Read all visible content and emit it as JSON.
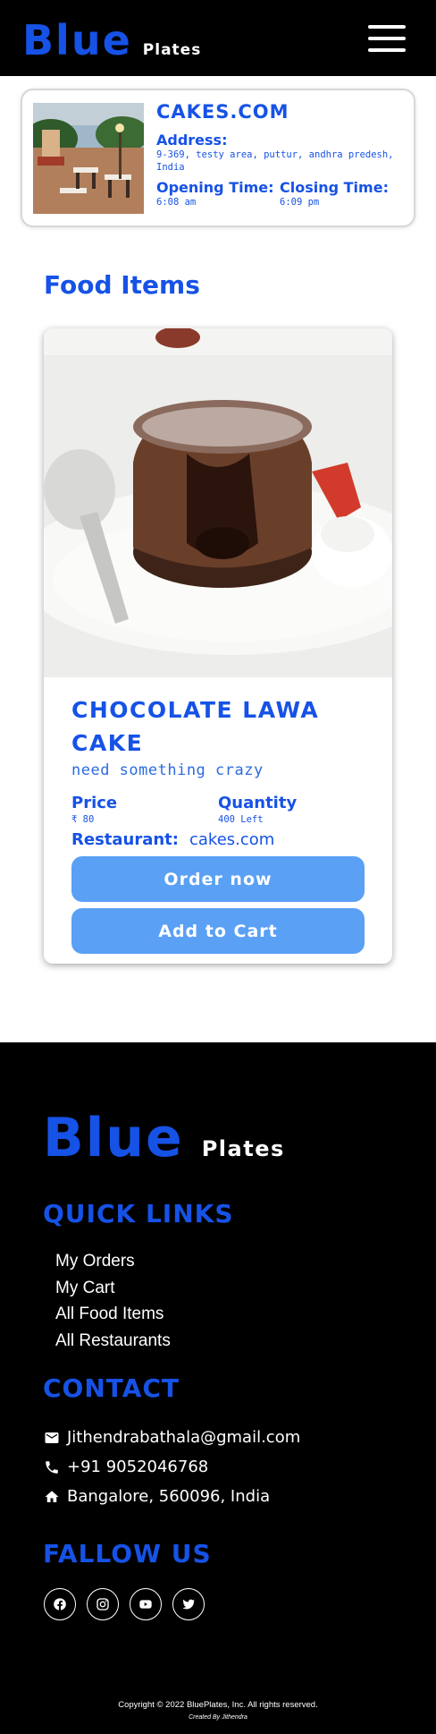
{
  "header": {
    "brand_main": "Blue",
    "brand_sub": "Plates",
    "menu_icon": "hamburger-menu-icon"
  },
  "restaurant": {
    "name": "CAKES.COM",
    "address_label": "Address:",
    "address": "9-369, testy area, puttur, andhra predesh, India",
    "opening_label": "Opening Time:",
    "opening_time": "6:08 am",
    "closing_label": "Closing Time:",
    "closing_time": "6:09 pm"
  },
  "section_title": "Food Items",
  "food": {
    "name": "CHOCOLATE LAWA CAKE",
    "description": "need something crazy",
    "price_label": "Price",
    "price": "₹ 80",
    "quantity_label": "Quantity",
    "quantity": "400 Left",
    "restaurant_label": "Restaurant:",
    "restaurant": "cakes.com",
    "order_button": "Order now",
    "cart_button": "Add to Cart"
  },
  "footer": {
    "brand_main": "Blue",
    "brand_sub": "Plates",
    "quick_links_title": "QUICK LINKS",
    "quick_links": [
      "My Orders",
      "My Cart",
      "All Food Items",
      "All Restaurants"
    ],
    "contact_title": "CONTACT",
    "contact": {
      "email": "Jithendrabathala@gmail.com",
      "phone": "+91 9052046768",
      "address": "Bangalore, 560096, India"
    },
    "follow_title": "FALLOW US",
    "socials": [
      "facebook-icon",
      "instagram-icon",
      "youtube-icon",
      "twitter-icon"
    ],
    "copyright": "Copyright © 2022 BluePlates, Inc. All rights reserved.",
    "created_by": "Created By Jithendra"
  },
  "colors": {
    "brand_blue": "#1652e6",
    "button_blue": "#5aa0f5",
    "header_bg": "#000000"
  }
}
